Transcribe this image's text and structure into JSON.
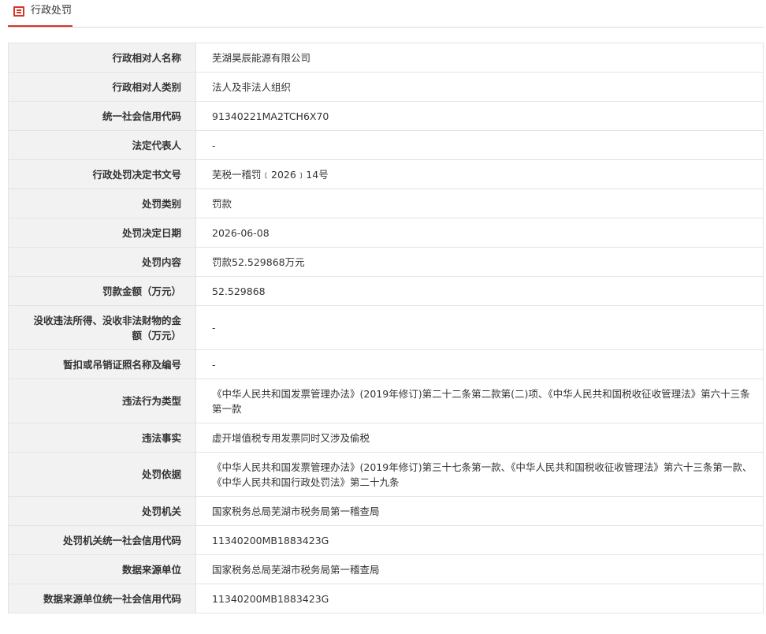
{
  "header": {
    "title": "行政处罚",
    "icon": "document-list-icon",
    "accent_color": "#d9342b"
  },
  "rows": [
    {
      "label": "行政相对人名称",
      "value": "芜湖昊辰能源有限公司"
    },
    {
      "label": "行政相对人类别",
      "value": "法人及非法人组织"
    },
    {
      "label": "统一社会信用代码",
      "value": "91340221MA2TCH6X70"
    },
    {
      "label": "法定代表人",
      "value": "-"
    },
    {
      "label": "行政处罚决定书文号",
      "value": "芜税一稽罚﹝2026﹞14号"
    },
    {
      "label": "处罚类别",
      "value": "罚款"
    },
    {
      "label": "处罚决定日期",
      "value": "2026-06-08"
    },
    {
      "label": "处罚内容",
      "value": "罚款52.529868万元"
    },
    {
      "label": "罚款金额（万元）",
      "value": "52.529868"
    },
    {
      "label": "没收违法所得、没收非法财物的金额（万元）",
      "value": "-"
    },
    {
      "label": "暂扣或吊销证照名称及编号",
      "value": "-"
    },
    {
      "label": "违法行为类型",
      "value": "《中华人民共和国发票管理办法》(2019年修订)第二十二条第二款第(二)项、《中华人民共和国税收征收管理法》第六十三条第一款"
    },
    {
      "label": "违法事实",
      "value": "虚开增值税专用发票同时又涉及偷税"
    },
    {
      "label": "处罚依据",
      "value": "《中华人民共和国发票管理办法》(2019年修订)第三十七条第一款、《中华人民共和国税收征收管理法》第六十三条第一款、《中华人民共和国行政处罚法》第二十九条"
    },
    {
      "label": "处罚机关",
      "value": "国家税务总局芜湖市税务局第一稽查局"
    },
    {
      "label": "处罚机关统一社会信用代码",
      "value": "11340200MB1883423G"
    },
    {
      "label": "数据来源单位",
      "value": "国家税务总局芜湖市税务局第一稽查局"
    },
    {
      "label": "数据来源单位统一社会信用代码",
      "value": "11340200MB1883423G"
    }
  ]
}
